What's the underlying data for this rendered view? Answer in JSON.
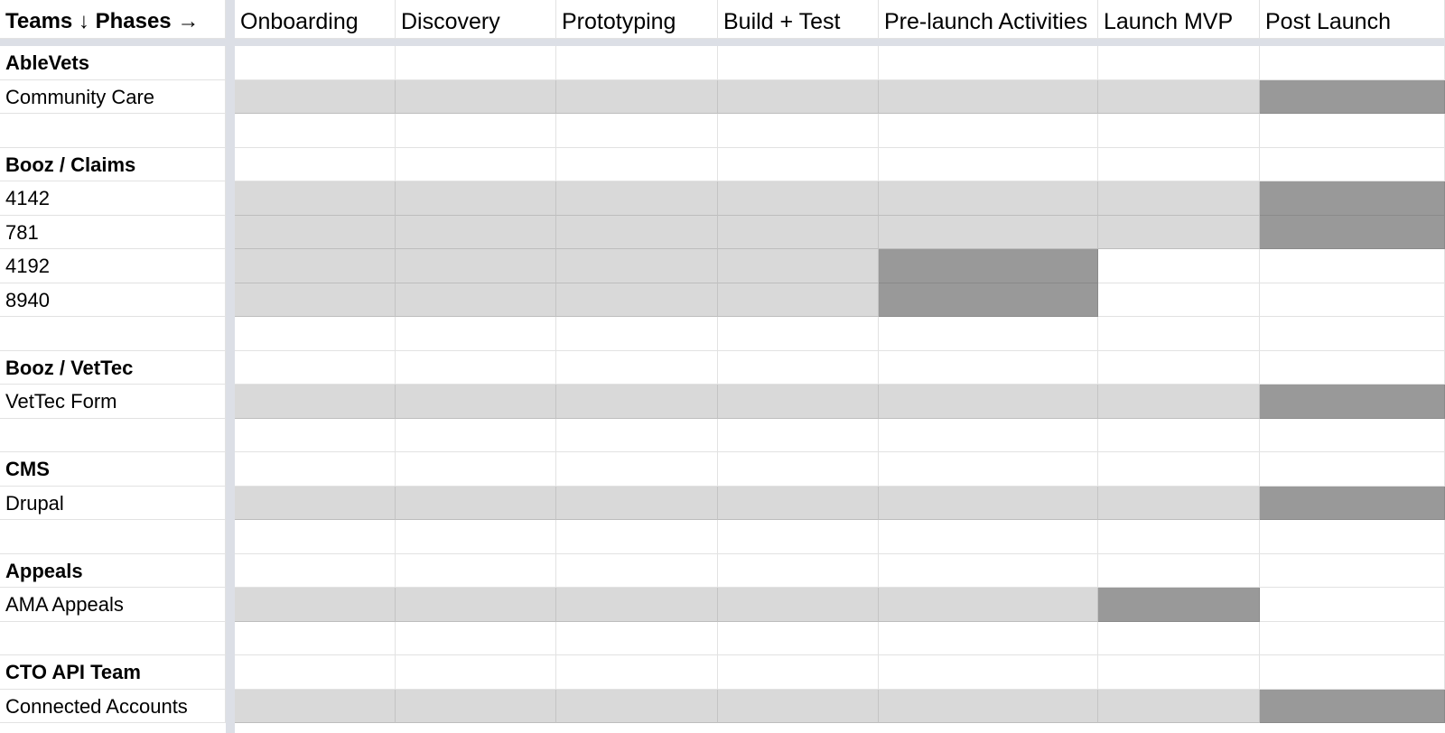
{
  "header": {
    "corner": "Teams ↓  Phases →",
    "phases": [
      "Onboarding",
      "Discovery",
      "Prototyping",
      "Build + Test",
      "Pre-launch Activities",
      "Launch MVP",
      "Post Launch"
    ]
  },
  "rows": [
    {
      "label": "AbleVets",
      "bold": true,
      "cells": [
        "",
        "",
        "",
        "",
        "",
        "",
        ""
      ]
    },
    {
      "label": "Community Care",
      "bold": false,
      "cells": [
        "light",
        "light",
        "light",
        "light",
        "light",
        "light",
        "dark"
      ]
    },
    {
      "label": "",
      "bold": false,
      "cells": [
        "",
        "",
        "",
        "",
        "",
        "",
        ""
      ]
    },
    {
      "label": "Booz / Claims",
      "bold": true,
      "cells": [
        "",
        "",
        "",
        "",
        "",
        "",
        ""
      ]
    },
    {
      "label": "4142",
      "bold": false,
      "cells": [
        "light",
        "light",
        "light",
        "light",
        "light",
        "light",
        "dark"
      ]
    },
    {
      "label": "781",
      "bold": false,
      "cells": [
        "light",
        "light",
        "light",
        "light",
        "light",
        "light",
        "dark"
      ]
    },
    {
      "label": "4192",
      "bold": false,
      "cells": [
        "light",
        "light",
        "light",
        "light",
        "dark",
        "",
        ""
      ]
    },
    {
      "label": "8940",
      "bold": false,
      "cells": [
        "light",
        "light",
        "light",
        "light",
        "dark",
        "",
        ""
      ]
    },
    {
      "label": "",
      "bold": false,
      "cells": [
        "",
        "",
        "",
        "",
        "",
        "",
        ""
      ]
    },
    {
      "label": "Booz / VetTec",
      "bold": true,
      "cells": [
        "",
        "",
        "",
        "",
        "",
        "",
        ""
      ]
    },
    {
      "label": "VetTec Form",
      "bold": false,
      "cells": [
        "light",
        "light",
        "light",
        "light",
        "light",
        "light",
        "dark"
      ]
    },
    {
      "label": "",
      "bold": false,
      "cells": [
        "",
        "",
        "",
        "",
        "",
        "",
        ""
      ]
    },
    {
      "label": "CMS",
      "bold": true,
      "cells": [
        "",
        "",
        "",
        "",
        "",
        "",
        ""
      ]
    },
    {
      "label": "Drupal",
      "bold": false,
      "cells": [
        "light",
        "light",
        "light",
        "light",
        "light",
        "light",
        "dark"
      ]
    },
    {
      "label": "",
      "bold": false,
      "cells": [
        "",
        "",
        "",
        "",
        "",
        "",
        ""
      ]
    },
    {
      "label": "Appeals",
      "bold": true,
      "cells": [
        "",
        "",
        "",
        "",
        "",
        "",
        ""
      ]
    },
    {
      "label": "AMA Appeals",
      "bold": false,
      "cells": [
        "light",
        "light",
        "light",
        "light",
        "light",
        "dark",
        ""
      ]
    },
    {
      "label": "",
      "bold": false,
      "cells": [
        "",
        "",
        "",
        "",
        "",
        "",
        ""
      ]
    },
    {
      "label": "CTO API Team",
      "bold": true,
      "cells": [
        "",
        "",
        "",
        "",
        "",
        "",
        ""
      ]
    },
    {
      "label": "Connected Accounts",
      "bold": false,
      "cells": [
        "light",
        "light",
        "light",
        "light",
        "light",
        "light",
        "dark"
      ]
    }
  ],
  "colors": {
    "light_fill": "#d9d9d9",
    "dark_fill": "#999999",
    "frozen_divider": "#dcdfe6",
    "gridline": "#e2e2e2"
  }
}
